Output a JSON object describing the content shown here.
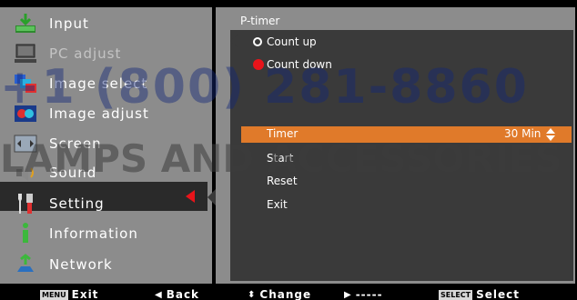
{
  "menu": {
    "items": [
      {
        "label": "Input",
        "icon": "input-icon",
        "disabled": false
      },
      {
        "label": "PC adjust",
        "icon": "pc-adjust-icon",
        "disabled": true
      },
      {
        "label": "Image select",
        "icon": "image-select-icon",
        "disabled": false
      },
      {
        "label": "Image adjust",
        "icon": "image-adjust-icon",
        "disabled": false
      },
      {
        "label": "Screen",
        "icon": "screen-icon",
        "disabled": false
      },
      {
        "label": "Sound",
        "icon": "sound-icon",
        "disabled": false
      },
      {
        "label": "Setting",
        "icon": "setting-icon",
        "disabled": false,
        "selected": true
      },
      {
        "label": "Information",
        "icon": "information-icon",
        "disabled": false
      },
      {
        "label": "Network",
        "icon": "network-icon",
        "disabled": false
      }
    ]
  },
  "submenu": {
    "title": "P-timer",
    "options": [
      {
        "label": "Count up",
        "marker": "ring"
      },
      {
        "label": "Count down",
        "marker": "red-dot"
      }
    ],
    "timer": {
      "label": "Timer",
      "value": "30 Min"
    },
    "actions": [
      "Start",
      "Reset",
      "Exit"
    ]
  },
  "watermark": {
    "line1": "+1 (800) 281-8860",
    "line2": "LAMPS AND ACCESSORIES"
  },
  "guide": {
    "exit": {
      "key": "MENU",
      "label": "Exit"
    },
    "back": {
      "glyph": "◀",
      "label": "Back"
    },
    "change": {
      "glyph": "⬍",
      "label": "Change"
    },
    "next": {
      "glyph": "▶",
      "label": "-----"
    },
    "select": {
      "key": "SELECT",
      "label": "Select"
    }
  },
  "colors": {
    "panel": "#8c8c8c",
    "submenu_bg": "#3a3a3a",
    "highlight": "#e07a2a",
    "accent_red": "#e8141a"
  }
}
